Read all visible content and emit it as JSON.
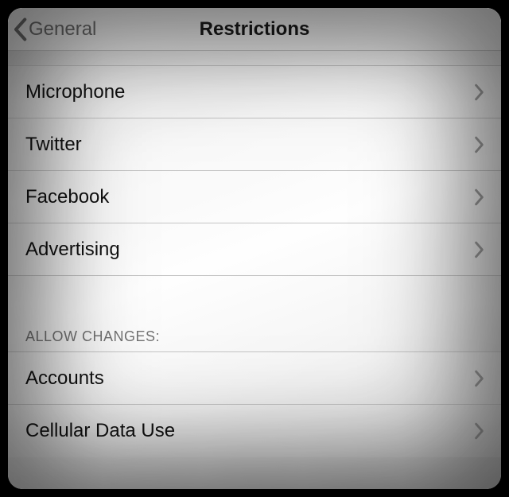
{
  "nav": {
    "back_label": "General",
    "title": "Restrictions"
  },
  "sections": [
    {
      "header": null,
      "items": [
        {
          "label": "Microphone"
        },
        {
          "label": "Twitter"
        },
        {
          "label": "Facebook"
        },
        {
          "label": "Advertising"
        }
      ]
    },
    {
      "header": "ALLOW CHANGES:",
      "items": [
        {
          "label": "Accounts"
        },
        {
          "label": "Cellular Data Use"
        }
      ]
    }
  ]
}
